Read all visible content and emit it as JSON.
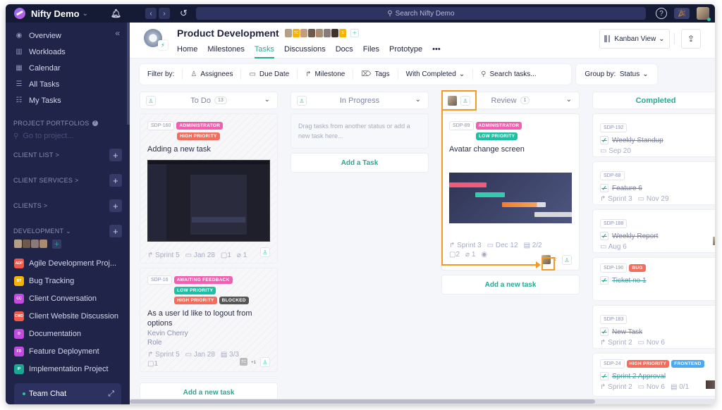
{
  "topbar": {
    "workspace": "Nifty Demo",
    "search_placeholder": "Search Nifty Demo",
    "icons": [
      "bell-icon",
      "back-icon",
      "forward-icon",
      "history-icon",
      "help-icon",
      "party-icon",
      "user-avatar"
    ]
  },
  "sidebar": {
    "nav": [
      {
        "label": "Overview",
        "icon": "compass-icon"
      },
      {
        "label": "Workloads",
        "icon": "chart-icon"
      },
      {
        "label": "Calendar",
        "icon": "calendar-icon"
      },
      {
        "label": "All Tasks",
        "icon": "list-icon"
      },
      {
        "label": "My Tasks",
        "icon": "checklist-icon"
      }
    ],
    "portfolios_label": "PROJECT PORTFOLIOS",
    "goto_placeholder": "Go to project...",
    "sections": [
      {
        "label": "CLIENT LIST",
        "chevron": ">"
      },
      {
        "label": "CLIENT SERVICES",
        "chevron": ">"
      },
      {
        "label": "CLIENTS",
        "chevron": ">"
      },
      {
        "label": "DEVELOPMENT",
        "chevron": "v"
      }
    ],
    "projects": [
      {
        "abbr": "ADP",
        "label": "Agile Development Proj...",
        "color": "#f0584a"
      },
      {
        "abbr": "BT",
        "label": "Bug Tracking",
        "color": "#f5b400"
      },
      {
        "abbr": "CC",
        "label": "Client Conversation",
        "color": "#c44be0"
      },
      {
        "abbr": "CWD",
        "label": "Client Website Discussion",
        "color": "#f0584a"
      },
      {
        "abbr": "D",
        "label": "Documentation",
        "color": "#c44be0"
      },
      {
        "abbr": "FD",
        "label": "Feature Deployment",
        "color": "#c44be0"
      },
      {
        "abbr": "IP",
        "label": "Implementation Project",
        "color": "#1aa893"
      }
    ],
    "team_chat": "Team Chat"
  },
  "header": {
    "project_title": "Product Development",
    "member_badges": [
      "TC",
      "S"
    ],
    "tabs": [
      "Home",
      "Milestones",
      "Tasks",
      "Discussions",
      "Docs",
      "Files",
      "Prototype",
      "•••"
    ],
    "active_tab": "Tasks",
    "view_label": "Kanban View"
  },
  "filters": {
    "label": "Filter by:",
    "items": [
      "Assignees",
      "Due Date",
      "Milestone",
      "Tags",
      "With Completed"
    ],
    "search_placeholder": "Search tasks...",
    "group_by_label": "Group by:",
    "group_by_value": "Status"
  },
  "columns": {
    "todo": {
      "title": "To Do",
      "count": "13",
      "cards": [
        {
          "id": "SDP-160",
          "tags": [
            "ADMINISTRATOR",
            "HIGH PRIORITY"
          ],
          "title": "Adding a new task",
          "sprint": "Sprint 5",
          "date": "Jan 28",
          "comments": "1",
          "attachments": "1"
        },
        {
          "id": "SDP-16",
          "tags": [
            "AWAITING FEEDBACK",
            "LOW PRIORITY",
            "HIGH PRIORITY",
            "BLOCKED"
          ],
          "title": "As a user Id like to logout from options",
          "field1": "Kevin Cherry",
          "field2": "Role",
          "sprint": "Sprint 5",
          "date": "Jan 28",
          "subtasks": "3/3",
          "comments": "1",
          "assignee": "TC",
          "extra": "+1"
        }
      ],
      "add_label": "Add a new task"
    },
    "in_progress": {
      "title": "In Progress",
      "empty_text": "Drag tasks from another status or add a new task here...",
      "add_label": "Add a Task"
    },
    "review": {
      "title": "Review",
      "count": "1",
      "cards": [
        {
          "id": "SDP-89",
          "tags": [
            "ADMINISTRATOR",
            "LOW PRIORITY"
          ],
          "title": "Avatar change screen",
          "sprint": "Sprint 3",
          "date": "Dec 12",
          "subtasks": "2/2",
          "comments": "2",
          "attachments": "1",
          "extra": "2"
        }
      ],
      "add_label": "Add a new task"
    },
    "completed": {
      "title": "Completed",
      "cards": [
        {
          "id": "SDP-192",
          "title": "Weekly Standup",
          "date": "Sep 20"
        },
        {
          "id": "SDP-68",
          "title": "Feature 6",
          "sprint": "Sprint 3",
          "date": "Nov 29"
        },
        {
          "id": "SDP-188",
          "title": "Weekly Report",
          "date": "Aug 6"
        },
        {
          "id": "SDP-190",
          "tags": [
            "BUG"
          ],
          "title": "Ticket no 1"
        },
        {
          "id": "SDP-183",
          "title": "New Task",
          "sprint": "Sprint 2",
          "date": "Nov 6"
        },
        {
          "id": "SDP-24",
          "tags": [
            "HIGH PRIORITY",
            "FRONTEND"
          ],
          "title": "Sprint 2 Approval",
          "sprint": "Sprint 2",
          "date": "Nov 6",
          "subtasks": "0/1"
        }
      ]
    }
  },
  "tag_colors": {
    "ADMINISTRATOR": "#f25fb0",
    "HIGH PRIORITY": "#f36d5c",
    "LOW PRIORITY": "#1fbfa3",
    "AWAITING FEEDBACK": "#f25fb0",
    "BLOCKED": "#555555",
    "BUG": "#f36d5c",
    "FRONTEND": "#4aa8f5"
  },
  "accent": "#2aa893",
  "highlight": "#f29a21"
}
